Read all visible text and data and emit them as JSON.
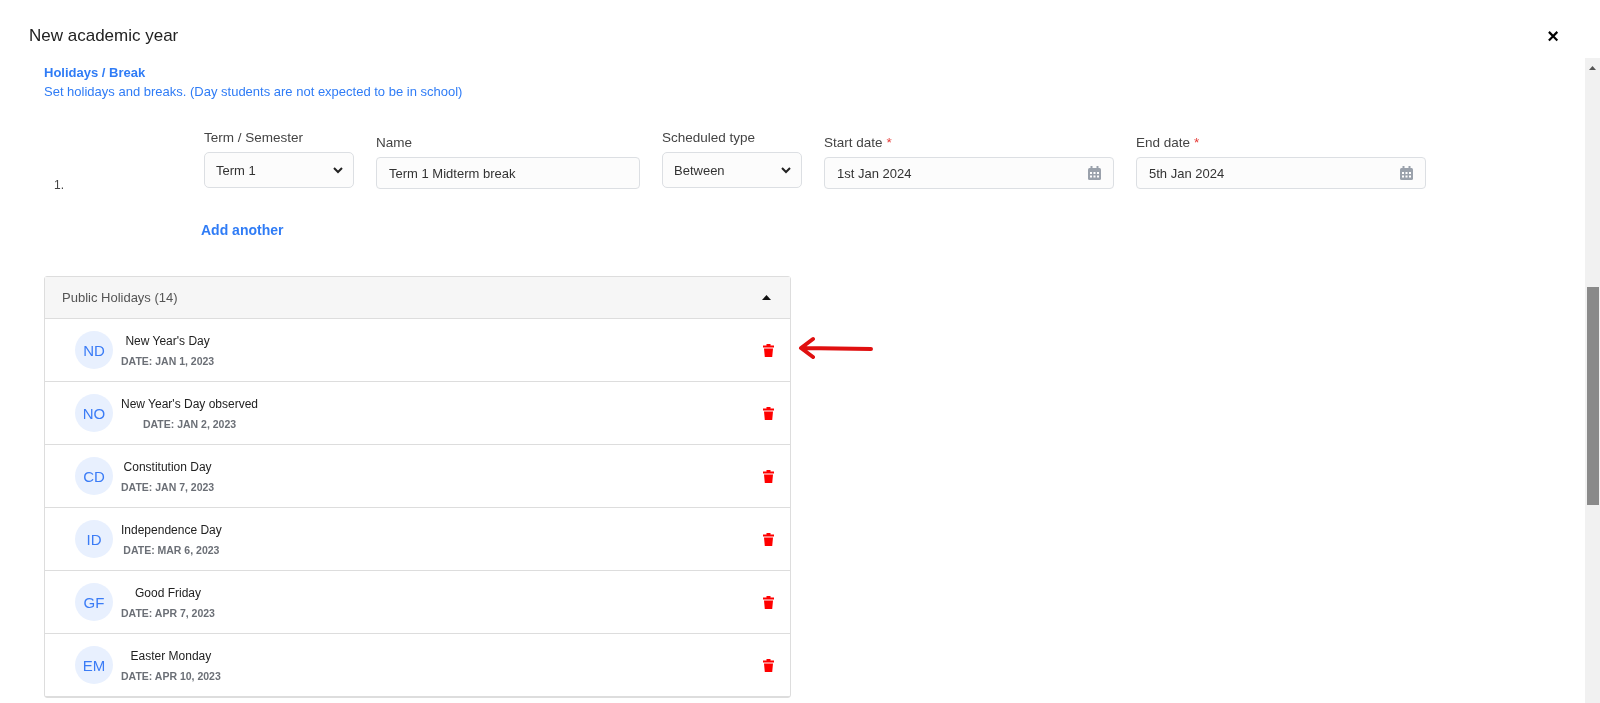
{
  "window": {
    "title": "New academic year",
    "close": "×"
  },
  "section": {
    "title": "Holidays / Break",
    "subtitle": "Set holidays and breaks. (Day students are not expected to be in school)"
  },
  "breaks": [
    {
      "number": "1.",
      "term": {
        "label": "Term / Semester",
        "value": "Term 1"
      },
      "name": {
        "label": "Name",
        "value": "Term 1 Midterm break"
      },
      "scheduled_type": {
        "label": "Scheduled type",
        "value": "Between"
      },
      "start_date": {
        "label": "Start date",
        "value": "1st Jan 2024",
        "required_mark": "*"
      },
      "end_date": {
        "label": "End date",
        "value": "5th Jan 2024",
        "required_mark": "*"
      }
    }
  ],
  "add_another": "Add another",
  "public_holidays": {
    "title": "Public Holidays (14)",
    "expanded": true,
    "items": [
      {
        "initials": "ND",
        "name": "New Year's Day",
        "date": "DATE: JAN 1, 2023"
      },
      {
        "initials": "NO",
        "name": "New Year's Day observed",
        "date": "DATE: JAN 2, 2023"
      },
      {
        "initials": "CD",
        "name": "Constitution Day",
        "date": "DATE: JAN 7, 2023"
      },
      {
        "initials": "ID",
        "name": "Independence Day",
        "date": "DATE: MAR 6, 2023"
      },
      {
        "initials": "GF",
        "name": "Good Friday",
        "date": "DATE: APR 7, 2023"
      },
      {
        "initials": "EM",
        "name": "Easter Monday",
        "date": "DATE: APR 10, 2023"
      }
    ]
  }
}
